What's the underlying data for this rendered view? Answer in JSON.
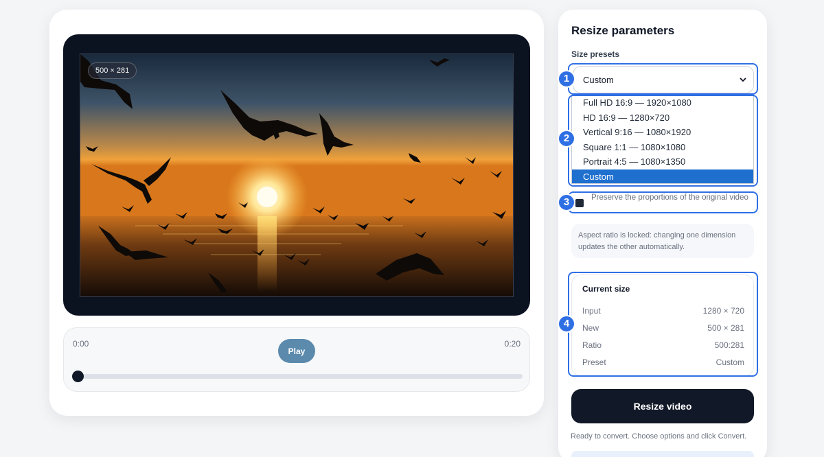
{
  "player": {
    "size_chip": "500 × 281",
    "time_start": "0:00",
    "time_end": "0:20",
    "play_label": "Play",
    "seek_progress": 0.0
  },
  "panel": {
    "title": "Resize parameters",
    "presets_label": "Size presets",
    "selected_preset": "Custom",
    "preset_options": [
      "Full HD 16:9 — 1920×1080",
      "HD 16:9 — 1280×720",
      "Vertical 9:16 — 1080×1920",
      "Square 1:1 — 1080×1080",
      "Portrait 4:5 — 1080×1350",
      "Custom"
    ],
    "preserve_label": "Preserve the proportions of the original video",
    "preserve_checked": true,
    "lock_note": "Aspect ratio is locked: changing one dimension updates the other automatically.",
    "current_size": {
      "title": "Current size",
      "rows": [
        {
          "label": "Input",
          "value": "1280 × 720"
        },
        {
          "label": "New",
          "value": "500 × 281"
        },
        {
          "label": "Ratio",
          "value": "500:281"
        },
        {
          "label": "Preset",
          "value": "Custom"
        }
      ]
    },
    "resize_button": "Resize video",
    "status": "Ready to convert. Choose options and click Convert."
  },
  "annotations": [
    "1",
    "2",
    "3",
    "4"
  ],
  "colors": {
    "accent": "#2f6fe4",
    "play_button": "#5b8aad",
    "primary_dark": "#111827",
    "selected_option": "#1f6fcf"
  }
}
